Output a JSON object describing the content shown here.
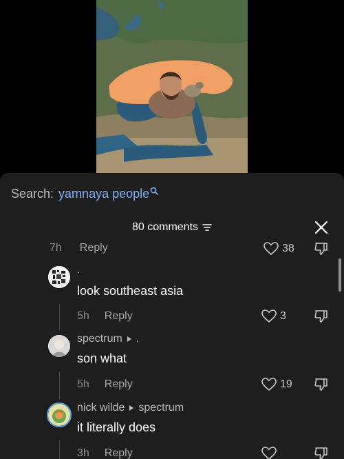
{
  "search": {
    "label": "Search:",
    "query": "yamnaya people",
    "icon": "search-icon"
  },
  "header": {
    "count_label": "80 comments",
    "filter_icon": "filter-lines-icon",
    "close_icon": "close-icon"
  },
  "comments": [
    {
      "time": "7h",
      "reply_label": "Reply",
      "likes": "38"
    },
    {
      "username": ".",
      "text": "look southeast asia",
      "time": "5h",
      "reply_label": "Reply",
      "likes": "3"
    },
    {
      "username": "spectrum",
      "reply_to": ".",
      "text": "son what",
      "time": "5h",
      "reply_label": "Reply",
      "likes": "19"
    },
    {
      "username": "nick wilde",
      "reply_to": "spectrum",
      "text": "it literally does",
      "time": "3h",
      "reply_label": "Reply"
    }
  ],
  "colors": {
    "sheet_bg": "#1e1e1e",
    "search_query": "#7fb2f5",
    "steppe_highlight": "#f0a064",
    "sea": "#2c5a7a"
  }
}
